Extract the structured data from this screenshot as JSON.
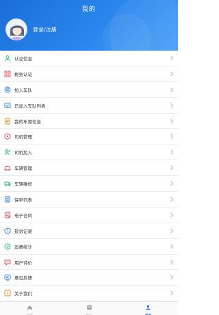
{
  "header": {
    "title": "我的"
  },
  "profile": {
    "login_label": "登录/注册"
  },
  "menu": [
    {
      "label": "认证信息",
      "icon": "person-icon",
      "color": "#18b46a"
    },
    {
      "label": "税务认证",
      "icon": "tax-icon",
      "color": "#e0484f"
    },
    {
      "label": "加入车队",
      "icon": "team-icon",
      "color": "#2f7be0"
    },
    {
      "label": "已加入车队列表",
      "icon": "list-check-icon",
      "color": "#2f7be0"
    },
    {
      "label": "我的车源信息",
      "icon": "truck-info-icon",
      "color": "#e58a1f"
    },
    {
      "label": "司机管理",
      "icon": "driver-manage-icon",
      "color": "#e0484f"
    },
    {
      "label": "司机加入",
      "icon": "driver-join-icon",
      "color": "#18b46a"
    },
    {
      "label": "车辆管理",
      "icon": "vehicle-manage-icon",
      "color": "#e0484f"
    },
    {
      "label": "车辆维修",
      "icon": "vehicle-repair-icon",
      "color": "#18b46a"
    },
    {
      "label": "保单列表",
      "icon": "policy-icon",
      "color": "#2f7be0"
    },
    {
      "label": "电子合同",
      "icon": "contract-icon",
      "color": "#e0484f"
    },
    {
      "label": "投诉记录",
      "icon": "complaint-icon",
      "color": "#2f7be0"
    },
    {
      "label": "运费统计",
      "icon": "freight-icon",
      "color": "#18b46a"
    },
    {
      "label": "用户评价",
      "icon": "review-icon",
      "color": "#e0484f"
    },
    {
      "label": "意见反馈",
      "icon": "feedback-icon",
      "color": "#2f7be0"
    },
    {
      "label": "关于我们",
      "icon": "about-icon",
      "color": "#e58a1f"
    }
  ],
  "tabbar": [
    {
      "label": "首页",
      "icon": "home-icon",
      "active": false
    },
    {
      "label": "车队",
      "icon": "fleet-icon",
      "active": false
    },
    {
      "label": "我的",
      "icon": "me-icon",
      "active": true
    }
  ],
  "colors": {
    "header_bg": "#1f78e0",
    "active_tab": "#1f6fd2"
  }
}
